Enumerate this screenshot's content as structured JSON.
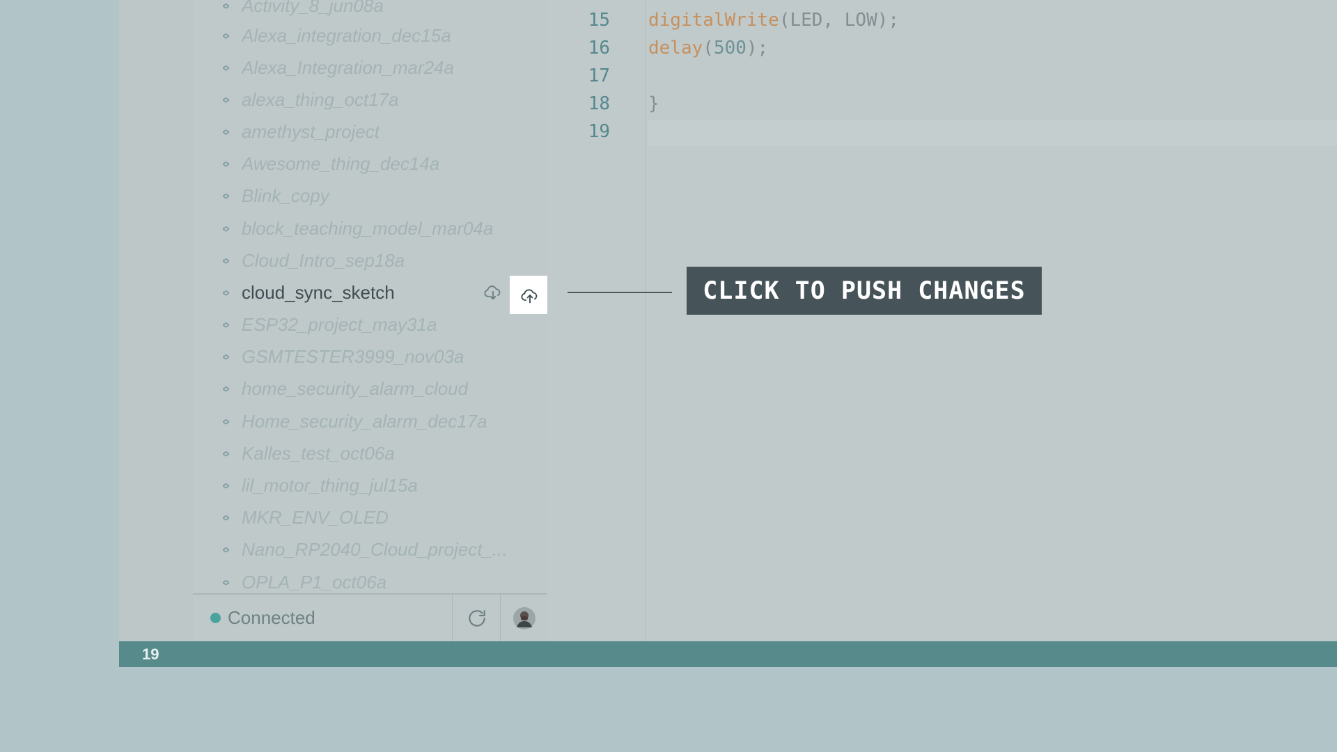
{
  "sidebar": {
    "sketches": [
      {
        "label": "Activity_8_jun08a"
      },
      {
        "label": "Alexa_integration_dec15a"
      },
      {
        "label": "Alexa_Integration_mar24a"
      },
      {
        "label": "alexa_thing_oct17a"
      },
      {
        "label": "amethyst_project"
      },
      {
        "label": "Awesome_thing_dec14a"
      },
      {
        "label": "Blink_copy"
      },
      {
        "label": "block_teaching_model_mar04a"
      },
      {
        "label": "Cloud_Intro_sep18a"
      },
      {
        "label": "cloud_sync_sketch"
      },
      {
        "label": "ESP32_project_may31a"
      },
      {
        "label": "GSMTESTER3999_nov03a"
      },
      {
        "label": "home_security_alarm_cloud"
      },
      {
        "label": "Home_security_alarm_dec17a"
      },
      {
        "label": "Kalles_test_oct06a"
      },
      {
        "label": "lil_motor_thing_jul15a"
      },
      {
        "label": "MKR_ENV_OLED"
      },
      {
        "label": "Nano_RP2040_Cloud_project_..."
      },
      {
        "label": "OPLA_P1_oct06a"
      }
    ],
    "active_sketch": "cloud_sync_sketch",
    "row_actions": {
      "pull_icon": "cloud-download-icon",
      "push_icon": "cloud-upload-icon"
    },
    "footer": {
      "status_label": "Connected",
      "status_color": "#4aa39c",
      "refresh_icon": "refresh-icon",
      "avatar_icon": "user-avatar"
    }
  },
  "editor": {
    "lines": [
      {
        "num": "15",
        "fn": "digitalWrite",
        "args": "(LED, LOW);"
      },
      {
        "num": "16",
        "fn": "delay",
        "open": "(",
        "number": "500",
        "close": ");"
      },
      {
        "num": "17",
        "text": ""
      },
      {
        "num": "18",
        "text": "}"
      },
      {
        "num": "19",
        "text": ""
      }
    ]
  },
  "tooltip": {
    "text": "CLICK TO PUSH CHANGES"
  },
  "status_bar": {
    "line_number": "19",
    "color": "#578a8b"
  }
}
